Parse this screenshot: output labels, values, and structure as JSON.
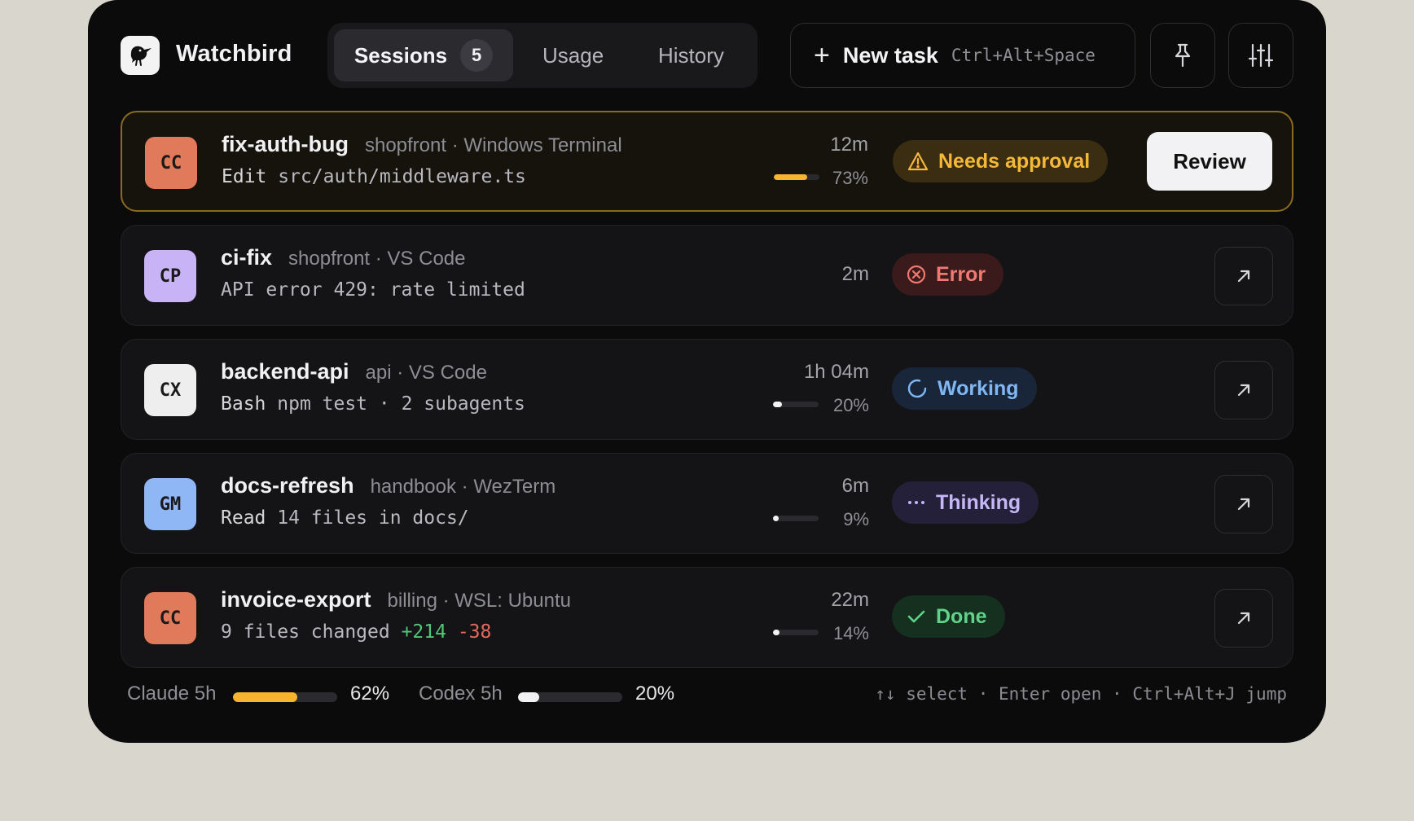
{
  "app": {
    "name": "Watchbird"
  },
  "tabs": [
    {
      "label": "Sessions",
      "count": "5",
      "active": true
    },
    {
      "label": "Usage"
    },
    {
      "label": "History"
    }
  ],
  "new_task": {
    "label": "New task",
    "shortcut": "Ctrl+Alt+Space"
  },
  "toolbar": {
    "pin_icon": "pin-icon",
    "settings_icon": "sliders-icon"
  },
  "sessions": [
    {
      "avatar": "CC",
      "avatar_color": "#e07a5a",
      "avatar_text_color": "#1a1a1a",
      "name": "fix-auth-bug",
      "meta": "shopfront · Windows Terminal",
      "detail_verb": "Edit",
      "detail": "src/auth/middleware.ts",
      "time": "12m",
      "progress": 0.73,
      "progress_label": "73%",
      "progress_color": "#f6b52c",
      "status": "Needs approval",
      "status_color": "#f4b938",
      "status_bg": "#3a2d12",
      "status_icon": "warning-icon",
      "action": "Review",
      "highlight": true
    },
    {
      "avatar": "CP",
      "avatar_color": "#c8b3f7",
      "avatar_text_color": "#1a1a1a",
      "name": "ci-fix",
      "meta": "shopfront · VS Code",
      "detail": "API error 429: rate limited",
      "time": "2m",
      "status": "Error",
      "status_color": "#f07a72",
      "status_bg": "#3a1a1b",
      "status_icon": "error-circle-icon"
    },
    {
      "avatar": "CX",
      "avatar_color": "#eeeeef",
      "avatar_text_color": "#1a1a1a",
      "name": "backend-api",
      "meta": "api · VS Code",
      "detail_verb": "Bash",
      "detail": "npm test · 2 subagents",
      "time": "1h 04m",
      "progress": 0.2,
      "progress_label": "20%",
      "progress_color": "#f2f2f4",
      "status": "Working",
      "status_color": "#7fb7f5",
      "status_bg": "#19263a",
      "status_icon": "spinner-icon"
    },
    {
      "avatar": "GM",
      "avatar_color": "#8fb7f6",
      "avatar_text_color": "#1a1a1a",
      "name": "docs-refresh",
      "meta": "handbook · WezTerm",
      "detail_verb": "Read",
      "detail": "14 files in docs/",
      "time": "6m",
      "progress": 0.09,
      "progress_label": "9%",
      "progress_color": "#f2f2f4",
      "status": "Thinking",
      "status_color": "#c5b6f5",
      "status_bg": "#24203a",
      "status_icon": "ellipsis-icon"
    },
    {
      "avatar": "CC",
      "avatar_color": "#e07a5a",
      "avatar_text_color": "#1a1a1a",
      "name": "invoice-export",
      "meta": "billing · WSL: Ubuntu",
      "detail": "9 files changed",
      "added": "+214",
      "removed": "-38",
      "time": "22m",
      "progress": 0.14,
      "progress_label": "14%",
      "progress_color": "#f2f2f4",
      "status": "Done",
      "status_color": "#5fd38a",
      "status_bg": "#15301f",
      "status_icon": "check-icon"
    }
  ],
  "footer": {
    "claude": {
      "label": "Claude 5h",
      "value": 0.62,
      "pct": "62%",
      "color": "#f6b52c"
    },
    "codex": {
      "label": "Codex 5h",
      "value": 0.2,
      "pct": "20%",
      "color": "#f2f2f4"
    },
    "hints": "↑↓ select · Enter open · Ctrl+Alt+J jump"
  }
}
